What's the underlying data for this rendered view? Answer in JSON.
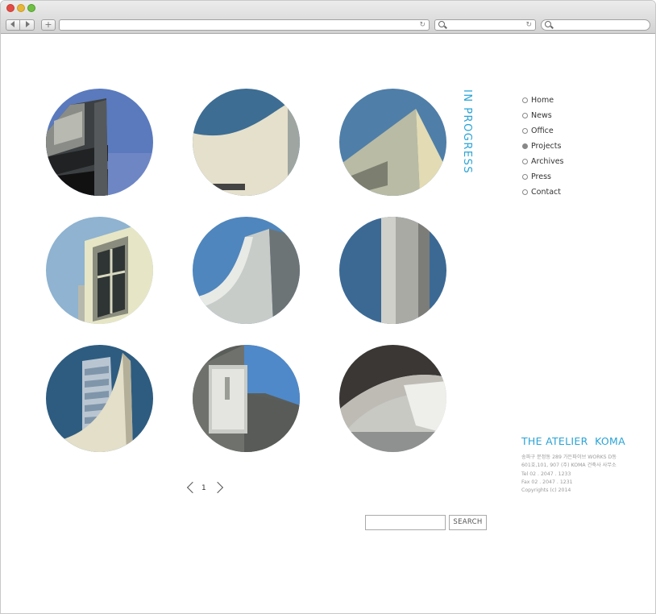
{
  "browser": {
    "back_icon": "triangle-left-icon",
    "forward_icon": "triangle-right-icon",
    "add_tab_label": "+",
    "reload_glyph": "↻",
    "colors": {
      "red": "#e24b43",
      "yellow": "#e6b638",
      "green": "#6fbf44"
    }
  },
  "page": {
    "section_title": "IN PROGRESS",
    "nav": [
      {
        "label": "Home",
        "active": false
      },
      {
        "label": "News",
        "active": false
      },
      {
        "label": "Office",
        "active": false
      },
      {
        "label": "Projects",
        "active": true
      },
      {
        "label": "Archives",
        "active": false
      },
      {
        "label": "Press",
        "active": false
      },
      {
        "label": "Contact",
        "active": false
      }
    ],
    "pagination": {
      "current": "1"
    },
    "search": {
      "placeholder": "",
      "button": "SEARCH"
    },
    "footer": {
      "brand": "THE ATELIER  KOMA",
      "address1": "송파구 문정동 289 가든파이브 WORKS D동",
      "address2": "601호,101, 907 (주) KOMA 건축사 사무소",
      "tel": "Tel 02 . 2047 . 1233",
      "fax": "Fax 02 . 2047 . 1231",
      "copyright": "Copyrights (c) 2014"
    },
    "accent_color": "#29a3d6"
  }
}
